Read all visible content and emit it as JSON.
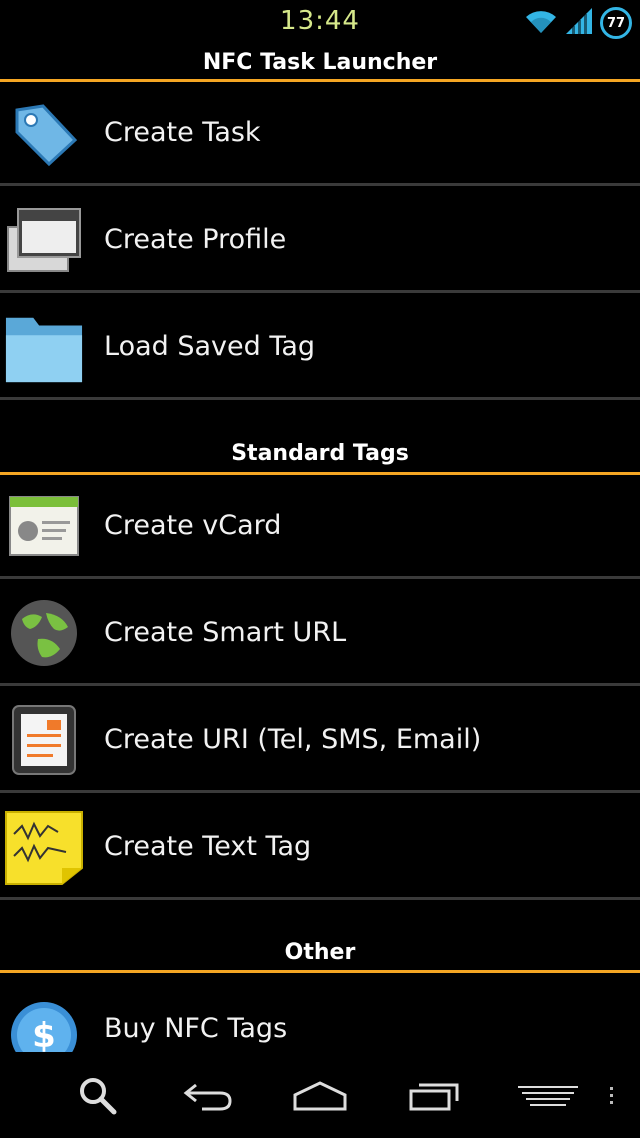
{
  "status_bar": {
    "time": "13:44",
    "battery_level": "77",
    "icons": [
      "wifi-icon",
      "cell-signal-icon",
      "battery-icon"
    ]
  },
  "app": {
    "title": "NFC Task Launcher"
  },
  "main_items": [
    {
      "label": "Create Task",
      "icon": "tag-icon"
    },
    {
      "label": "Create Profile",
      "icon": "windows-stack-icon"
    },
    {
      "label": "Load Saved Tag",
      "icon": "folder-icon"
    }
  ],
  "standard_tags": {
    "header": "Standard Tags",
    "items": [
      {
        "label": "Create vCard",
        "icon": "vcard-icon"
      },
      {
        "label": "Create Smart URL",
        "icon": "globe-icon"
      },
      {
        "label": "Create URI (Tel, SMS, Email)",
        "icon": "document-icon"
      },
      {
        "label": "Create Text Tag",
        "icon": "sticky-note-icon"
      }
    ]
  },
  "other": {
    "header": "Other",
    "items": [
      {
        "label": "Buy NFC Tags",
        "icon": "dollar-coin-icon"
      }
    ]
  },
  "nav_bar": {
    "buttons": [
      "search-icon",
      "back-icon",
      "home-icon",
      "recent-apps-icon",
      "menu-icon",
      "overflow-icon"
    ]
  },
  "colors": {
    "accent": "#f5a623",
    "divider": "#3a3a3a",
    "time": "#d6e88a"
  }
}
